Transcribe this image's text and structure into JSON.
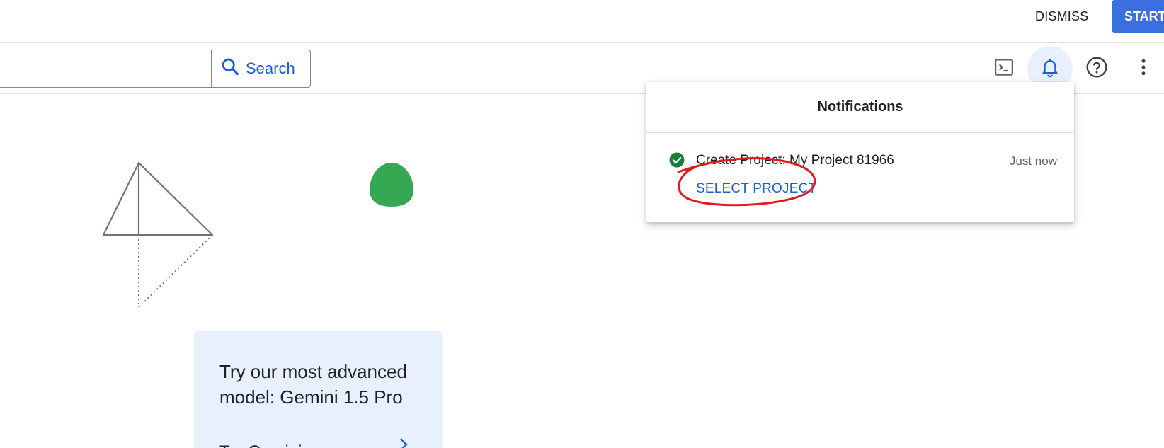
{
  "banner": {
    "dismiss_label": "DISMISS",
    "start_label": "START"
  },
  "header": {
    "search": {
      "value": "",
      "button_label": "Search"
    },
    "icons": [
      "terminal-icon",
      "notifications-bell-icon",
      "help-icon",
      "more-vert-icon"
    ]
  },
  "promo": {
    "title_line1": "Try our most advanced",
    "title_line2": "model: Gemini 1.5 Pro",
    "link_text": "Try Gemini"
  },
  "notifications": {
    "title": "Notifications",
    "items": [
      {
        "text": "Create Project: My Project 81966",
        "time": "Just now",
        "action": "SELECT PROJECT",
        "status_icon": "check-circle-icon"
      }
    ]
  },
  "colors": {
    "accent": "#1a5fd6",
    "start_button": "#3b6fe0",
    "success": "#188038",
    "annotation": "#e01b1b",
    "promo_bg": "#e8f0fe",
    "blob": "#34a853"
  }
}
